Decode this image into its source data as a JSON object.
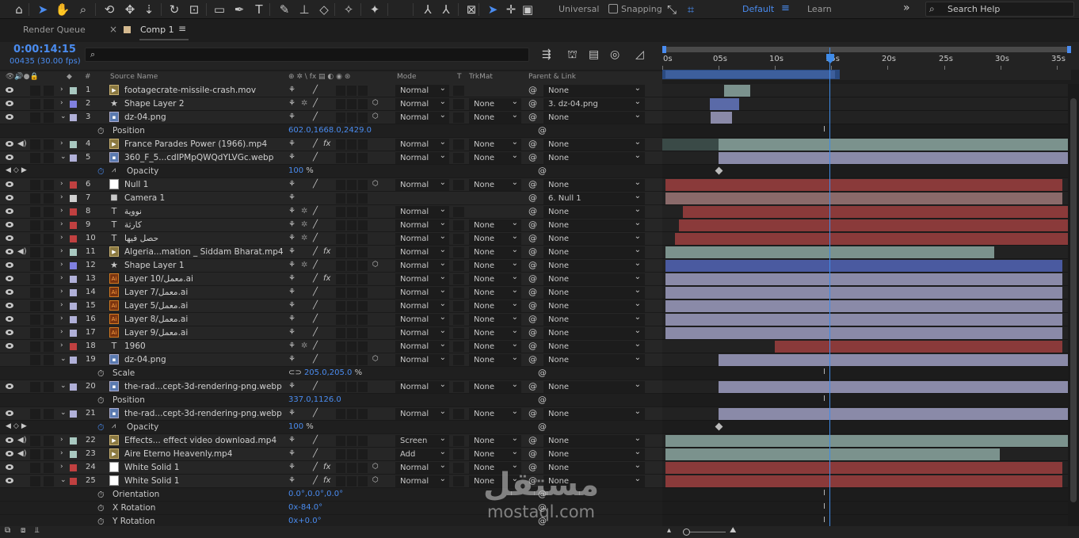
{
  "toolbar": {
    "tools": [
      {
        "icon": "home-icon",
        "glyph": "⌂"
      },
      {
        "icon": "selection-tool-icon",
        "glyph": "➤"
      },
      {
        "icon": "hand-tool-icon",
        "glyph": "✋"
      },
      {
        "icon": "zoom-tool-icon",
        "glyph": "⌕"
      },
      {
        "icon": "orbit-camera-icon",
        "glyph": "⟲"
      },
      {
        "icon": "pan-camera-icon",
        "glyph": "✥"
      },
      {
        "icon": "dolly-camera-icon",
        "glyph": "⇣"
      },
      {
        "icon": "rotate-tool-icon",
        "glyph": "↻"
      },
      {
        "icon": "anchor-point-tool-icon",
        "glyph": "⊡"
      },
      {
        "icon": "rectangle-tool-icon",
        "glyph": "▭"
      },
      {
        "icon": "pen-tool-icon",
        "glyph": "✒"
      },
      {
        "icon": "type-tool-icon",
        "glyph": "T"
      },
      {
        "icon": "brush-tool-icon",
        "glyph": "✎"
      },
      {
        "icon": "clone-stamp-icon",
        "glyph": "⊥"
      },
      {
        "icon": "eraser-tool-icon",
        "glyph": "◇"
      },
      {
        "icon": "roto-brush-icon",
        "glyph": "✧"
      },
      {
        "icon": "puppet-pin-icon",
        "glyph": "✦"
      }
    ],
    "axis_mode_label": "Universal",
    "snapping_label": "Snapping"
  },
  "workspace": {
    "default_label": "Default",
    "learn_label": "Learn",
    "search_placeholder": "Search Help"
  },
  "tabs": {
    "render_queue": "Render Queue",
    "comp": "Comp 1"
  },
  "comp": {
    "timecode": "0:00:14:15",
    "frames": "00435 (30.00 fps)"
  },
  "ruler": {
    "ticks": [
      "0s",
      "05s",
      "10s",
      "15s",
      "20s",
      "25s",
      "30s",
      "35s"
    ]
  },
  "columns": {
    "num": "#",
    "source_name": "Source Name",
    "mode": "Mode",
    "t": "T",
    "trkmat": "TrkMat",
    "parent": "Parent & Link"
  },
  "rows": [
    {
      "kind": "layer",
      "num": "1",
      "name": "footagecrate-missile-crash.mov",
      "color": "#a8c8c0",
      "type": "vid",
      "eye": true,
      "audio": false,
      "twisty": "›",
      "fx": false,
      "cube": false,
      "mode": "Normal",
      "trk": "",
      "parent": "None"
    },
    {
      "kind": "layer",
      "num": "2",
      "name": "Shape Layer 2",
      "color": "#8080e0",
      "type": "shape",
      "eye": true,
      "audio": false,
      "twisty": "›",
      "fx": false,
      "cube": true,
      "mode": "Normal",
      "trk": "None",
      "parent": "3. dz-04.png"
    },
    {
      "kind": "layer",
      "num": "3",
      "name": "dz-04.png",
      "color": "#b0b0d8",
      "type": "img",
      "eye": true,
      "audio": false,
      "twisty": "⌄",
      "fx": false,
      "cube": true,
      "mode": "Normal",
      "trk": "None",
      "parent": "None"
    },
    {
      "kind": "prop",
      "name": "Position",
      "val": "602.0,1668.0,2429.0",
      "unit": "",
      "keyed": false
    },
    {
      "kind": "layer",
      "num": "4",
      "name": "France Parades Power (1966).mp4",
      "color": "#a8c8c0",
      "type": "vid",
      "eye": true,
      "audio": true,
      "twisty": "›",
      "fx": true,
      "cube": false,
      "mode": "Normal",
      "trk": "None",
      "parent": "None"
    },
    {
      "kind": "layer",
      "num": "5",
      "name": "360_F_5...cdIPMpQWQdYLVGc.webp",
      "color": "#b0b0d8",
      "type": "img",
      "eye": true,
      "audio": false,
      "twisty": "⌄",
      "fx": false,
      "cube": false,
      "mode": "Normal",
      "trk": "None",
      "parent": "None"
    },
    {
      "kind": "prop",
      "name": "Opacity",
      "val": "100",
      "unit": "%",
      "keyed": true
    },
    {
      "kind": "layer",
      "num": "6",
      "name": "Null 1",
      "color": "#c04040",
      "type": "sol",
      "eye": true,
      "audio": false,
      "twisty": "›",
      "fx": false,
      "cube": true,
      "mode": "Normal",
      "trk": "None",
      "parent": "None"
    },
    {
      "kind": "layer",
      "num": "7",
      "name": "Camera 1",
      "color": "#d0d0d0",
      "type": "cam",
      "eye": true,
      "audio": false,
      "twisty": "›",
      "fx": false,
      "cube": false,
      "mode": "",
      "trk": "",
      "parent": "6. Null 1"
    },
    {
      "kind": "layer",
      "num": "8",
      "name": "نووية",
      "color": "#c04040",
      "type": "text",
      "eye": true,
      "audio": false,
      "twisty": "›",
      "fx": false,
      "cube": false,
      "mode": "Normal",
      "trk": "",
      "parent": "None"
    },
    {
      "kind": "layer",
      "num": "9",
      "name": "كارثة",
      "color": "#c04040",
      "type": "text",
      "eye": true,
      "audio": false,
      "twisty": "›",
      "fx": false,
      "cube": false,
      "mode": "Normal",
      "trk": "None",
      "parent": "None"
    },
    {
      "kind": "layer",
      "num": "10",
      "name": "حصل فيها",
      "color": "#c04040",
      "type": "text",
      "eye": true,
      "audio": false,
      "twisty": "›",
      "fx": false,
      "cube": false,
      "mode": "Normal",
      "trk": "None",
      "parent": "None"
    },
    {
      "kind": "layer",
      "num": "11",
      "name": "Algeria...mation _ Siddam Bharat.mp4",
      "color": "#a8c8c0",
      "type": "vid",
      "eye": true,
      "audio": true,
      "twisty": "›",
      "fx": true,
      "cube": false,
      "mode": "Normal",
      "trk": "None",
      "parent": "None"
    },
    {
      "kind": "layer",
      "num": "12",
      "name": "Shape Layer 1",
      "color": "#8080e0",
      "type": "shape",
      "eye": true,
      "audio": false,
      "twisty": "›",
      "fx": false,
      "cube": true,
      "mode": "Normal",
      "trk": "None",
      "parent": "None"
    },
    {
      "kind": "layer",
      "num": "13",
      "name": "Layer 10/معمل.ai",
      "color": "#b0b0d8",
      "type": "ai",
      "eye": true,
      "audio": false,
      "twisty": "›",
      "fx": true,
      "cube": false,
      "mode": "Normal",
      "trk": "None",
      "parent": "None"
    },
    {
      "kind": "layer",
      "num": "14",
      "name": "Layer 7/معمل.ai",
      "color": "#b0b0d8",
      "type": "ai",
      "eye": true,
      "audio": false,
      "twisty": "›",
      "fx": false,
      "cube": false,
      "mode": "Normal",
      "trk": "None",
      "parent": "None"
    },
    {
      "kind": "layer",
      "num": "15",
      "name": "Layer 5/معمل.ai",
      "color": "#b0b0d8",
      "type": "ai",
      "eye": true,
      "audio": false,
      "twisty": "›",
      "fx": false,
      "cube": false,
      "mode": "Normal",
      "trk": "None",
      "parent": "None"
    },
    {
      "kind": "layer",
      "num": "16",
      "name": "Layer 8/معمل.ai",
      "color": "#b0b0d8",
      "type": "ai",
      "eye": true,
      "audio": false,
      "twisty": "›",
      "fx": false,
      "cube": false,
      "mode": "Normal",
      "trk": "None",
      "parent": "None"
    },
    {
      "kind": "layer",
      "num": "17",
      "name": "Layer 9/معمل.ai",
      "color": "#b0b0d8",
      "type": "ai",
      "eye": true,
      "audio": false,
      "twisty": "›",
      "fx": false,
      "cube": false,
      "mode": "Normal",
      "trk": "None",
      "parent": "None"
    },
    {
      "kind": "layer",
      "num": "18",
      "name": "1960",
      "color": "#c04040",
      "type": "text",
      "eye": true,
      "audio": false,
      "twisty": "›",
      "fx": false,
      "cube": false,
      "mode": "Normal",
      "trk": "None",
      "parent": "None"
    },
    {
      "kind": "layer",
      "num": "19",
      "name": "dz-04.png",
      "color": "#b0b0d8",
      "type": "img",
      "eye": false,
      "audio": false,
      "twisty": "⌄",
      "fx": false,
      "cube": true,
      "mode": "Normal",
      "trk": "None",
      "parent": "None"
    },
    {
      "kind": "prop",
      "name": "Scale",
      "val": "205.0,205.0",
      "unit": "%",
      "keyed": false,
      "link": true
    },
    {
      "kind": "layer",
      "num": "20",
      "name": "the-rad...cept-3d-rendering-png.webp",
      "color": "#b0b0d8",
      "type": "img",
      "eye": true,
      "audio": false,
      "twisty": "⌄",
      "fx": false,
      "cube": false,
      "mode": "Normal",
      "trk": "None",
      "parent": "None"
    },
    {
      "kind": "prop",
      "name": "Position",
      "val": "337.0,1126.0",
      "unit": "",
      "keyed": false
    },
    {
      "kind": "layer",
      "num": "21",
      "name": "the-rad...cept-3d-rendering-png.webp",
      "color": "#b0b0d8",
      "type": "img",
      "eye": true,
      "audio": false,
      "twisty": "⌄",
      "fx": false,
      "cube": false,
      "mode": "Normal",
      "trk": "None",
      "parent": "None"
    },
    {
      "kind": "prop",
      "name": "Opacity",
      "val": "100",
      "unit": "%",
      "keyed": true
    },
    {
      "kind": "layer",
      "num": "22",
      "name": "Effects... effect video download.mp4",
      "color": "#a8c8c0",
      "type": "vid",
      "eye": true,
      "audio": true,
      "twisty": "›",
      "fx": false,
      "cube": false,
      "mode": "Screen",
      "trk": "None",
      "parent": "None"
    },
    {
      "kind": "layer",
      "num": "23",
      "name": "Aire Eterno Heavenly.mp4",
      "color": "#a8c8c0",
      "type": "vid",
      "eye": true,
      "audio": true,
      "twisty": "›",
      "fx": false,
      "cube": false,
      "mode": "Add",
      "trk": "None",
      "parent": "None"
    },
    {
      "kind": "layer",
      "num": "24",
      "name": "White Solid 1",
      "color": "#c04040",
      "type": "sol",
      "eye": true,
      "audio": false,
      "twisty": "›",
      "fx": true,
      "cube": true,
      "mode": "Normal",
      "trk": "None",
      "parent": "None"
    },
    {
      "kind": "layer",
      "num": "25",
      "name": "White Solid 1",
      "color": "#c04040",
      "type": "sol",
      "eye": true,
      "audio": false,
      "twisty": "⌄",
      "fx": true,
      "cube": true,
      "mode": "Normal",
      "trk": "None",
      "parent": "None"
    },
    {
      "kind": "prop",
      "name": "Orientation",
      "val": "0.0°,0.0°,0.0°",
      "unit": "",
      "keyed": false
    },
    {
      "kind": "prop",
      "name": "X Rotation",
      "val": "0x-84.0°",
      "unit": "",
      "keyed": false
    },
    {
      "kind": "prop",
      "name": "Y Rotation",
      "val": "0x+0.0°",
      "unit": "",
      "keyed": false
    }
  ],
  "tracks": [
    {
      "start": 5.5,
      "end": 7.8,
      "color": "#7b928d"
    },
    {
      "start": 4.2,
      "end": 6.8,
      "color": "#5a6aa8"
    },
    {
      "start": 4.3,
      "end": 6.2,
      "color": "#8a8aa8"
    },
    {
      "ibeam": true
    },
    {
      "start": 0,
      "end": 36,
      "color": "#7b928d",
      "pre": 5
    },
    {
      "start": 5,
      "end": 36,
      "color": "#8a8aa8"
    },
    {
      "kfs": [
        5
      ]
    },
    {
      "start": 0.3,
      "end": 35.5,
      "color": "#8a3a3a"
    },
    {
      "start": 0.3,
      "end": 35.5,
      "color": "#8a6a6a"
    },
    {
      "start": 1.8,
      "end": 36,
      "color": "#8a3a3a"
    },
    {
      "start": 1.5,
      "end": 36,
      "color": "#8a3a3a"
    },
    {
      "start": 1.1,
      "end": 36,
      "color": "#8a3a3a"
    },
    {
      "start": 0.3,
      "end": 29.5,
      "color": "#7b928d"
    },
    {
      "start": 0.3,
      "end": 35.5,
      "color": "#4a5aa0"
    },
    {
      "start": 0.3,
      "end": 35.5,
      "color": "#8a8aa8"
    },
    {
      "start": 0.3,
      "end": 35.5,
      "color": "#8a8aa8"
    },
    {
      "start": 0.3,
      "end": 35.5,
      "color": "#8a8aa8"
    },
    {
      "start": 0.3,
      "end": 35.5,
      "color": "#8a8aa8"
    },
    {
      "start": 0.3,
      "end": 35.5,
      "color": "#8a8aa8"
    },
    {
      "start": 10.0,
      "end": 35.5,
      "color": "#8a3a3a"
    },
    {
      "start": 5,
      "end": 36,
      "color": "#8a8aa8"
    },
    {
      "ibeam": true
    },
    {
      "start": 5,
      "end": 36,
      "color": "#8a8aa8"
    },
    {
      "ibeam": true
    },
    {
      "start": 5,
      "end": 36,
      "color": "#8a8aa8"
    },
    {
      "kfs": [
        5
      ]
    },
    {
      "start": 0.3,
      "end": 36,
      "color": "#7b928d"
    },
    {
      "start": 0.3,
      "end": 30,
      "color": "#7b928d"
    },
    {
      "start": 0.3,
      "end": 35.5,
      "color": "#8a3a3a"
    },
    {
      "start": 0.3,
      "end": 35.5,
      "color": "#8a3a3a"
    },
    {
      "ibeam": true
    },
    {
      "ibeam": true
    },
    {
      "ibeam": true
    }
  ],
  "timeline": {
    "duration_s": 36,
    "current_s": 14.5
  },
  "watermark": {
    "ar": "مستقل",
    "en": "mostaql.com"
  }
}
